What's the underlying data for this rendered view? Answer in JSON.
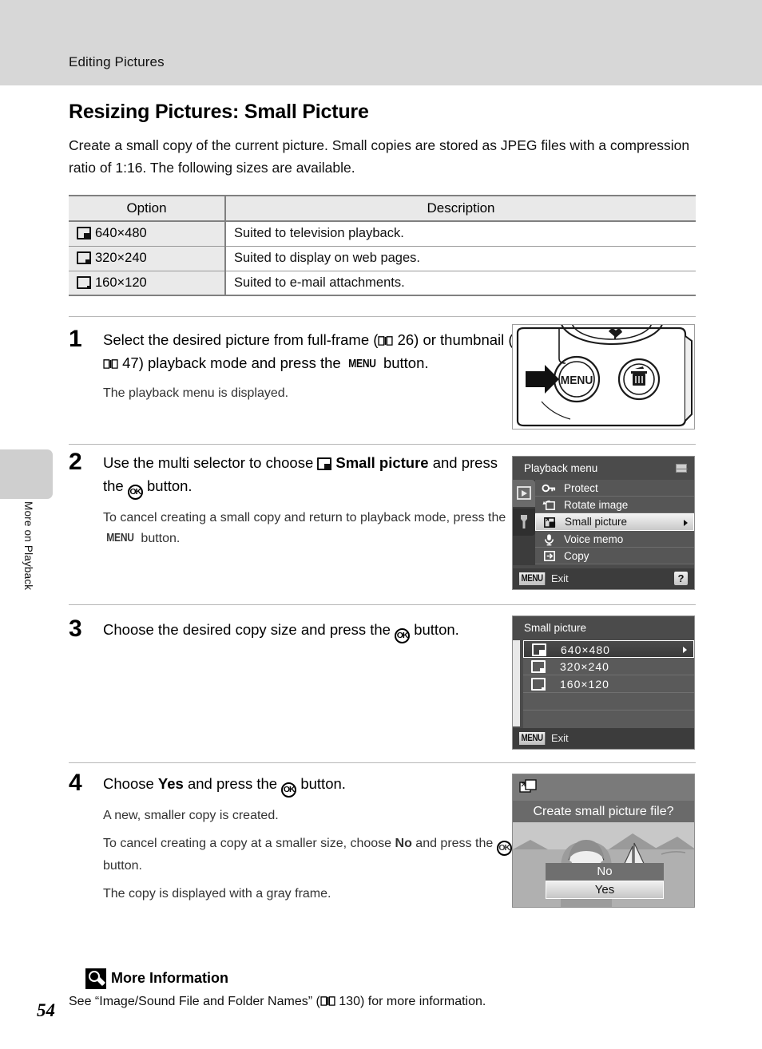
{
  "header": {
    "running_title": "Editing Pictures"
  },
  "side_tab": {
    "label": "More on Playback"
  },
  "page": {
    "number": "54"
  },
  "section": {
    "title": "Resizing Pictures: Small Picture",
    "intro": "Create a small copy of the current picture. Small copies are stored as JPEG files with a compression ratio of 1:16. The following sizes are available."
  },
  "table": {
    "headers": [
      "Option",
      "Description"
    ],
    "rows": [
      {
        "icon": "small-picture-640-icon",
        "option": "640×480",
        "description": "Suited to television playback."
      },
      {
        "icon": "small-picture-320-icon",
        "option": "320×240",
        "description": "Suited to display on web pages."
      },
      {
        "icon": "small-picture-160-icon",
        "option": "160×120",
        "description": "Suited to e-mail attachments."
      }
    ]
  },
  "steps": [
    {
      "number": "1",
      "lead_a": "Select the desired picture from full-frame (",
      "ref1": "26",
      "lead_b": ") or thumbnail (",
      "ref2": "47",
      "lead_c": ") playback mode and press the ",
      "menu_word": "MENU",
      "lead_d": " button.",
      "sub": "The playback menu is displayed."
    },
    {
      "number": "2",
      "lead_a": "Use the multi selector to choose ",
      "bold_a": "Small picture",
      "lead_b": " and press the ",
      "ok_word": "OK",
      "lead_c": " button.",
      "sub_a": "To cancel creating a small copy and return to playback mode, press the ",
      "menu_word": "MENU",
      "sub_b": " button."
    },
    {
      "number": "3",
      "lead_a": "Choose the desired copy size and press the ",
      "ok_word": "OK",
      "lead_b": " button."
    },
    {
      "number": "4",
      "lead_a": "Choose ",
      "bold_yes": "Yes",
      "lead_b": " and press the ",
      "ok_word": "OK",
      "lead_c": " button.",
      "sub1": "A new, smaller copy is created.",
      "sub2_a": "To cancel creating a copy at a smaller size, choose ",
      "bold_no": "No",
      "sub2_b": " and press the ",
      "sub2_c": " button.",
      "sub3": "The copy is displayed with a gray frame."
    }
  ],
  "camera_figure": {
    "menu_button_label": "MENU",
    "delete_button_icon": "trash-icon",
    "macro_icon": "macro-flower-icon",
    "pointer_icon": "arrow-right-icon"
  },
  "lcd_playback_menu": {
    "title": "Playback menu",
    "battery_icon": "battery-icon",
    "tabs": [
      {
        "icon": "playback-tab-icon",
        "active": true
      },
      {
        "icon": "setup-wrench-tab-icon",
        "active": false
      }
    ],
    "items": [
      {
        "icon": "key-protect-icon",
        "label": "Protect",
        "selected": false
      },
      {
        "icon": "rotate-image-icon",
        "label": "Rotate image",
        "selected": false
      },
      {
        "icon": "small-picture-icon",
        "label": "Small picture",
        "selected": true
      },
      {
        "icon": "microphone-icon",
        "label": "Voice memo",
        "selected": false
      },
      {
        "icon": "copy-icon",
        "label": "Copy",
        "selected": false
      }
    ],
    "footer": {
      "badge": "MENU",
      "label": "Exit",
      "help": "?"
    }
  },
  "lcd_small_picture": {
    "title": "Small picture",
    "items": [
      {
        "icon": "small-picture-640-icon",
        "label": "640×480",
        "selected": true
      },
      {
        "icon": "small-picture-320-icon",
        "label": "320×240",
        "selected": false
      },
      {
        "icon": "small-picture-160-icon",
        "label": "160×120",
        "selected": false
      }
    ],
    "footer": {
      "badge": "MENU",
      "label": "Exit"
    }
  },
  "lcd_confirm": {
    "icon": "small-picture-icon",
    "question": "Create small picture file?",
    "options": [
      {
        "label": "No",
        "selected": false
      },
      {
        "label": "Yes",
        "selected": true
      }
    ]
  },
  "more_information": {
    "icon": "magnifier-icon",
    "title": "More Information",
    "text_a": "See “Image/Sound File and Folder Names” (",
    "ref": "130",
    "text_b": ") for more information."
  },
  "colors": {
    "header_band": "#d7d7d7",
    "table_header": "#e9e9e9",
    "lcd_background": "#4b4b4b",
    "lcd_row": "#565656",
    "highlight": "#f2f2f2"
  }
}
